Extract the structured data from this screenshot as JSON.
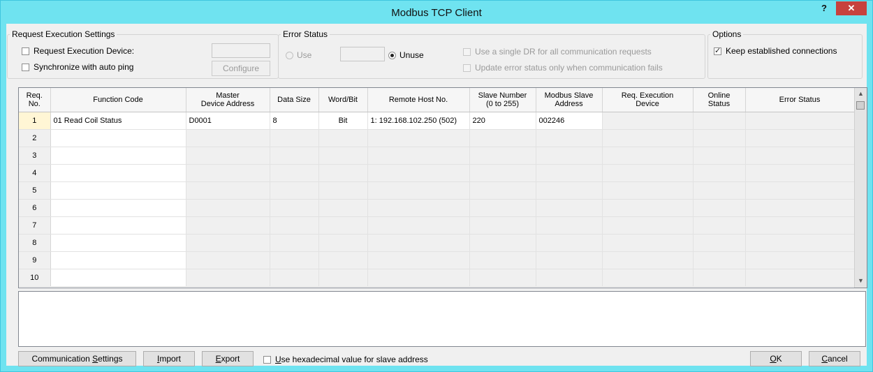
{
  "window": {
    "title": "Modbus TCP Client",
    "help_label": "?",
    "close_label": "✕"
  },
  "request_execution": {
    "group_title": "Request Execution Settings",
    "device_label": "Request Execution Device:",
    "device_checked": false,
    "auto_ping_label": "Synchronize with auto ping",
    "auto_ping_checked": false,
    "device_value": "",
    "configure_label": "Configure"
  },
  "error_status": {
    "group_title": "Error Status",
    "use_label": "Use",
    "unuse_label": "Unuse",
    "selected": "Unuse",
    "address_value": "",
    "single_dr_label": "Use a single DR for all communication requests",
    "update_only_label": "Update error status only when communication fails"
  },
  "options": {
    "group_title": "Options",
    "keep_connections_label": "Keep established connections",
    "keep_connections_checked": true
  },
  "table": {
    "columns": [
      "Req.\nNo.",
      "Function Code",
      "Master\nDevice Address",
      "Data Size",
      "Word/Bit",
      "Remote Host No.",
      "Slave Number\n(0 to 255)",
      "Modbus Slave\nAddress",
      "Req. Execution\nDevice",
      "Online\nStatus",
      "Error Status"
    ],
    "rows": [
      [
        "1",
        "01 Read Coil Status",
        "D0001",
        "8",
        "Bit",
        "1: 192.168.102.250 (502)",
        "220",
        "002246",
        "",
        "",
        ""
      ],
      [
        "2",
        "",
        "",
        "",
        "",
        "",
        "",
        "",
        "",
        "",
        ""
      ],
      [
        "3",
        "",
        "",
        "",
        "",
        "",
        "",
        "",
        "",
        "",
        ""
      ],
      [
        "4",
        "",
        "",
        "",
        "",
        "",
        "",
        "",
        "",
        "",
        ""
      ],
      [
        "5",
        "",
        "",
        "",
        "",
        "",
        "",
        "",
        "",
        "",
        ""
      ],
      [
        "6",
        "",
        "",
        "",
        "",
        "",
        "",
        "",
        "",
        "",
        ""
      ],
      [
        "7",
        "",
        "",
        "",
        "",
        "",
        "",
        "",
        "",
        "",
        ""
      ],
      [
        "8",
        "",
        "",
        "",
        "",
        "",
        "",
        "",
        "",
        "",
        ""
      ],
      [
        "9",
        "",
        "",
        "",
        "",
        "",
        "",
        "",
        "",
        "",
        ""
      ],
      [
        "10",
        "",
        "",
        "",
        "",
        "",
        "",
        "",
        "",
        "",
        ""
      ]
    ]
  },
  "footer": {
    "comm_settings_label": "Communication Settings",
    "comm_settings_mnemonic": "S",
    "import_label": "Import",
    "export_label": "Export",
    "hex_label": "Use hexadecimal value for slave address",
    "hex_checked": false,
    "ok_label": "OK",
    "cancel_label": "Cancel"
  },
  "colors": {
    "titlebar": "#6fe3f0",
    "close": "#c7413e",
    "active_row": "#fff6d5"
  }
}
